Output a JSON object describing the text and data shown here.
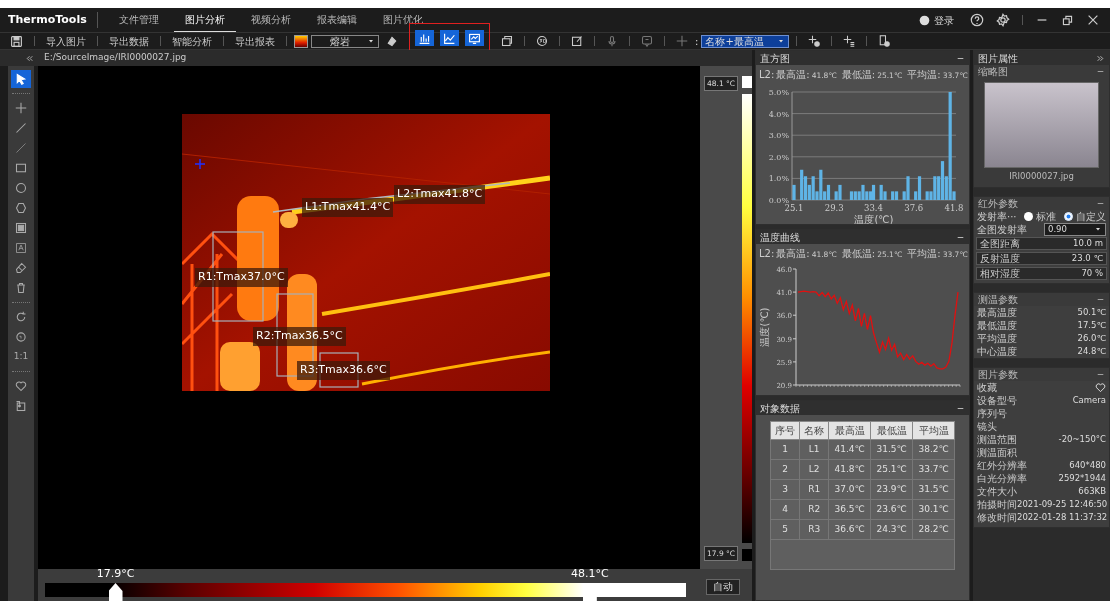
{
  "window": {
    "app_name": "ThermoTools",
    "tabs": [
      {
        "label": "文件管理",
        "selected": false
      },
      {
        "label": "图片分析",
        "selected": true
      },
      {
        "label": "视频分析",
        "selected": false
      },
      {
        "label": "报表编辑",
        "selected": false
      },
      {
        "label": "图片优化",
        "selected": false
      }
    ],
    "login": "登录"
  },
  "toolbar": {
    "actions": [
      "导入图片",
      "导出数据",
      "智能分析",
      "导出报表"
    ],
    "palette": "熔岩",
    "view_toggles": [
      {
        "kind": "histogram",
        "on": true
      },
      {
        "kind": "curve",
        "on": true
      },
      {
        "kind": "data",
        "on": true
      }
    ],
    "label_mode_caption": ":",
    "label_mode": "名称+最高温"
  },
  "file_path": "E:/SourceImage/IRI0000027.jpg",
  "tool_groups": [
    [
      {
        "kind": "pointer",
        "selected": true
      }
    ],
    [
      {
        "kind": "point",
        "selected": false
      },
      {
        "kind": "line",
        "selected": false
      },
      {
        "kind": "polyline",
        "selected": false
      },
      {
        "kind": "rect",
        "selected": false
      },
      {
        "kind": "circle",
        "selected": false
      },
      {
        "kind": "polygon",
        "selected": false
      },
      {
        "kind": "fullframe",
        "selected": false
      },
      {
        "kind": "textbox",
        "selected": false
      },
      {
        "kind": "eraser",
        "selected": false
      },
      {
        "kind": "trash",
        "selected": false
      }
    ],
    [
      {
        "kind": "rotate",
        "selected": false
      },
      {
        "kind": "rotate90",
        "selected": false
      },
      {
        "kind": "label",
        "label": "1:1",
        "selected": false
      }
    ],
    [
      {
        "kind": "heart",
        "selected": false
      },
      {
        "kind": "import",
        "selected": false
      }
    ]
  ],
  "measurements": [
    {
      "kind": "line",
      "label": "L1:Tmax41.4°C"
    },
    {
      "kind": "line",
      "label": "L2:Tmax41.8°C"
    },
    {
      "kind": "rect",
      "label": "R1:Tmax37.0°C"
    },
    {
      "kind": "rect",
      "label": "R2:Tmax36.5°C"
    },
    {
      "kind": "rect",
      "label": "R3:Tmax36.6°C"
    }
  ],
  "scale": {
    "max": "48.1 °C",
    "min": "17.9 °C"
  },
  "range_bar": {
    "low": {
      "label": "17.9°C",
      "level": 0.11
    },
    "high": {
      "label": "48.1°C",
      "level": 0.85
    },
    "auto_button": "自动"
  },
  "histogram": {
    "title": "直方图",
    "stats": {
      "line": "L2:",
      "items": [
        {
          "label": "最高温:",
          "value": "41.8℃"
        },
        {
          "label": "最低温:",
          "value": "25.1℃"
        },
        {
          "label": "平均温:",
          "value": "33.7℃"
        }
      ]
    },
    "chart_data": {
      "type": "bar",
      "grid": true,
      "xlabel": "温度(℃)",
      "xlim": [
        25.1,
        41.8
      ],
      "ylim": [
        0,
        5
      ],
      "xticks": [
        25.1,
        29.3,
        33.4,
        37.6,
        41.8
      ],
      "yticks": [
        {
          "value": 0,
          "label": "0.0%"
        },
        {
          "value": 1,
          "label": "1.0%"
        },
        {
          "value": 2,
          "label": "2.0%"
        },
        {
          "value": 3,
          "label": "3.0%"
        },
        {
          "value": 4,
          "label": "4.0%"
        },
        {
          "value": 5,
          "label": "5.0%"
        }
      ],
      "x": [
        25.1,
        25.9,
        26.3,
        26.7,
        27.1,
        27.5,
        27.9,
        28.3,
        28.7,
        29.5,
        29.9,
        31.1,
        31.5,
        31.9,
        32.3,
        32.7,
        33.1,
        33.4,
        34.2,
        34.6,
        35.4,
        35.8,
        36.6,
        37.0,
        37.8,
        38.2,
        39.0,
        39.4,
        39.8,
        40.2,
        40.6,
        41.0,
        41.4,
        41.8
      ],
      "values": [
        0.7,
        1.4,
        1.1,
        0.7,
        1.1,
        0.4,
        1.4,
        0.4,
        0.7,
        0.4,
        0.7,
        0.4,
        0.4,
        0.4,
        0.7,
        0.4,
        0.4,
        0.7,
        0.7,
        0.4,
        0.4,
        0.4,
        0.4,
        1.1,
        0.4,
        1.1,
        0.4,
        0.4,
        1.1,
        1.1,
        1.8,
        1.1,
        5.0,
        0.4
      ]
    }
  },
  "temperature_curve": {
    "title": "温度曲线",
    "stats": {
      "line": "L2:",
      "items": [
        {
          "label": "最高温:",
          "value": "41.8℃"
        },
        {
          "label": "最低温:",
          "value": "25.1℃"
        },
        {
          "label": "平均温:",
          "value": "33.7℃"
        }
      ]
    },
    "chart_data": {
      "type": "line",
      "ylabel": "温度(℃)",
      "ylim": [
        20.9,
        46.0
      ],
      "yticks": [
        {
          "value": 20.9,
          "label": "20.9"
        },
        {
          "value": 25.9,
          "label": "25.9"
        },
        {
          "value": 30.9,
          "label": "30.9"
        },
        {
          "value": 36.0,
          "label": "36.0"
        },
        {
          "value": 41.0,
          "label": "41.0"
        },
        {
          "value": 46.0,
          "label": "46.0"
        }
      ],
      "series": [
        {
          "color": "#e01010",
          "values": [
            41.0,
            41.1,
            41.2,
            41.1,
            41.0,
            41.1,
            41.0,
            40.2,
            40.9,
            40.0,
            40.8,
            39.5,
            40.3,
            38.6,
            39.8,
            37.2,
            39.0,
            36.4,
            38.2,
            34.8,
            37.5,
            33.6,
            36.4,
            32.9,
            35.9,
            32.2,
            30.0,
            28.0,
            30.2,
            28.6,
            31.0,
            28.4,
            29.7,
            27.0,
            27.8,
            26.4,
            27.5,
            26.5,
            27.2,
            26.0,
            25.4,
            25.8,
            25.2,
            25.6,
            25.0,
            25.5,
            24.6,
            24.4,
            24.4,
            24.8,
            26.0,
            30.0,
            36.0,
            41.0
          ]
        }
      ]
    }
  },
  "object_data": {
    "title": "对象数据",
    "columns": [
      "序号",
      "名称",
      "最高温",
      "最低温",
      "平均温"
    ],
    "rows": [
      [
        "1",
        "L1",
        "41.4℃",
        "31.5℃",
        "38.2℃"
      ],
      [
        "2",
        "L2",
        "41.8℃",
        "25.1℃",
        "33.7℃"
      ],
      [
        "3",
        "R1",
        "37.0℃",
        "23.9℃",
        "31.5℃"
      ],
      [
        "4",
        "R2",
        "36.5℃",
        "23.6℃",
        "30.1℃"
      ],
      [
        "5",
        "R3",
        "36.6℃",
        "24.3℃",
        "28.2℃"
      ]
    ]
  },
  "image_properties": {
    "title": "图片属性",
    "thumbnail": {
      "title": "缩略图",
      "filename": "IRI0000027.jpg"
    },
    "infrared": {
      "title": "红外参数",
      "emissivity_label": "发射率···",
      "modes": [
        {
          "label": "标准",
          "selected": false
        },
        {
          "label": "自定义",
          "selected": true
        }
      ],
      "emissivity": {
        "label": "全图发射率",
        "value": "0.90"
      },
      "fields": [
        {
          "label": "全图距离",
          "value": "10.0 m"
        },
        {
          "label": "反射温度",
          "value": "23.0 ℃"
        },
        {
          "label": "相对湿度",
          "value": "70 %"
        }
      ]
    },
    "measurement": {
      "title": "测温参数",
      "rows": [
        {
          "label": "最高温度",
          "value": "50.1℃"
        },
        {
          "label": "最低温度",
          "value": "17.5℃"
        },
        {
          "label": "平均温度",
          "value": "26.0℃"
        },
        {
          "label": "中心温度",
          "value": "24.8℃"
        }
      ]
    },
    "picture": {
      "title": "图片参数",
      "rows": [
        {
          "kind": "favorite",
          "label": "收藏",
          "favorite": false
        },
        {
          "kind": "text",
          "label": "设备型号",
          "value": "Camera"
        },
        {
          "kind": "text",
          "label": "序列号"
        },
        {
          "kind": "text",
          "label": "镜头"
        },
        {
          "kind": "text",
          "label": "测温范围",
          "value": "-20~150°C"
        },
        {
          "kind": "text",
          "label": "测温面积"
        },
        {
          "kind": "text",
          "label": "红外分辨率",
          "value": "640*480"
        },
        {
          "kind": "text",
          "label": "白光分辨率",
          "value": "2592*1944"
        },
        {
          "kind": "text",
          "label": "文件大小",
          "value": "663KB"
        },
        {
          "kind": "text",
          "label": "拍摄时间",
          "value": "2021-09-25 12:46:50"
        },
        {
          "kind": "text",
          "label": "修改时间",
          "value": "2022-01-28 11:37:32"
        }
      ]
    }
  }
}
